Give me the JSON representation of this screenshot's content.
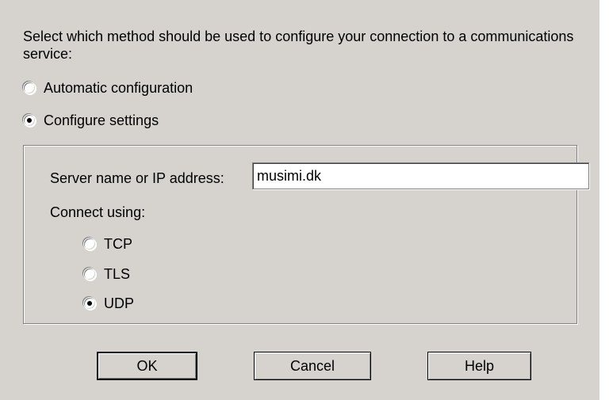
{
  "dialog": {
    "intro_text": "Select which method should be used to configure your connection to a communications service:",
    "method_options": [
      {
        "label": "Automatic configuration",
        "selected": false
      },
      {
        "label": "Configure settings",
        "selected": true
      }
    ],
    "server": {
      "label": "Server name or IP address:",
      "value": "musimi.dk"
    },
    "connect_using": {
      "label": "Connect using:",
      "options": [
        {
          "label": "TCP",
          "selected": false
        },
        {
          "label": "TLS",
          "selected": false
        },
        {
          "label": "UDP",
          "selected": true
        }
      ]
    },
    "buttons": {
      "ok": "OK",
      "cancel": "Cancel",
      "help": "Help"
    }
  },
  "colors": {
    "dialog_background": "#d6d3ce",
    "input_background": "#ffffff",
    "border_dark": "#808080"
  }
}
